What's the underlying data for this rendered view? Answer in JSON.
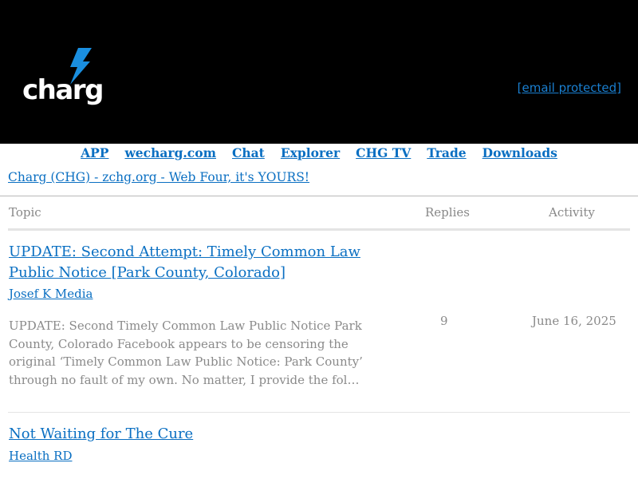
{
  "header": {
    "logo_text": "charg",
    "email_link": "[email protected]",
    "colors": {
      "background": "#000000",
      "accent": "#1a7fd0"
    }
  },
  "nav": {
    "items": [
      {
        "label": "APP"
      },
      {
        "label": "wecharg.com"
      },
      {
        "label": "Chat"
      },
      {
        "label": "Explorer"
      },
      {
        "label": "CHG TV"
      },
      {
        "label": "Trade"
      },
      {
        "label": "Downloads"
      }
    ]
  },
  "site_link": "Charg (CHG) - zchg.org - Web Four, it's YOURS!",
  "table": {
    "headers": {
      "topic": "Topic",
      "replies": "Replies",
      "activity": "Activity"
    },
    "rows": [
      {
        "title": "UPDATE: Second Attempt: Timely Common Law Public Notice [Park County, Colorado]",
        "author": "Josef K Media",
        "excerpt": "UPDATE: Second Timely Common Law Public Notice Park County, Colorado Facebook appears to be censoring the original ‘Timely Common Law Public Notice: Park County’ through no fault of my own. No matter, I provide the fol…",
        "replies": "9",
        "activity": "June 16, 2025"
      },
      {
        "title": "Not Waiting for The Cure",
        "author": "Health RD"
      }
    ]
  }
}
